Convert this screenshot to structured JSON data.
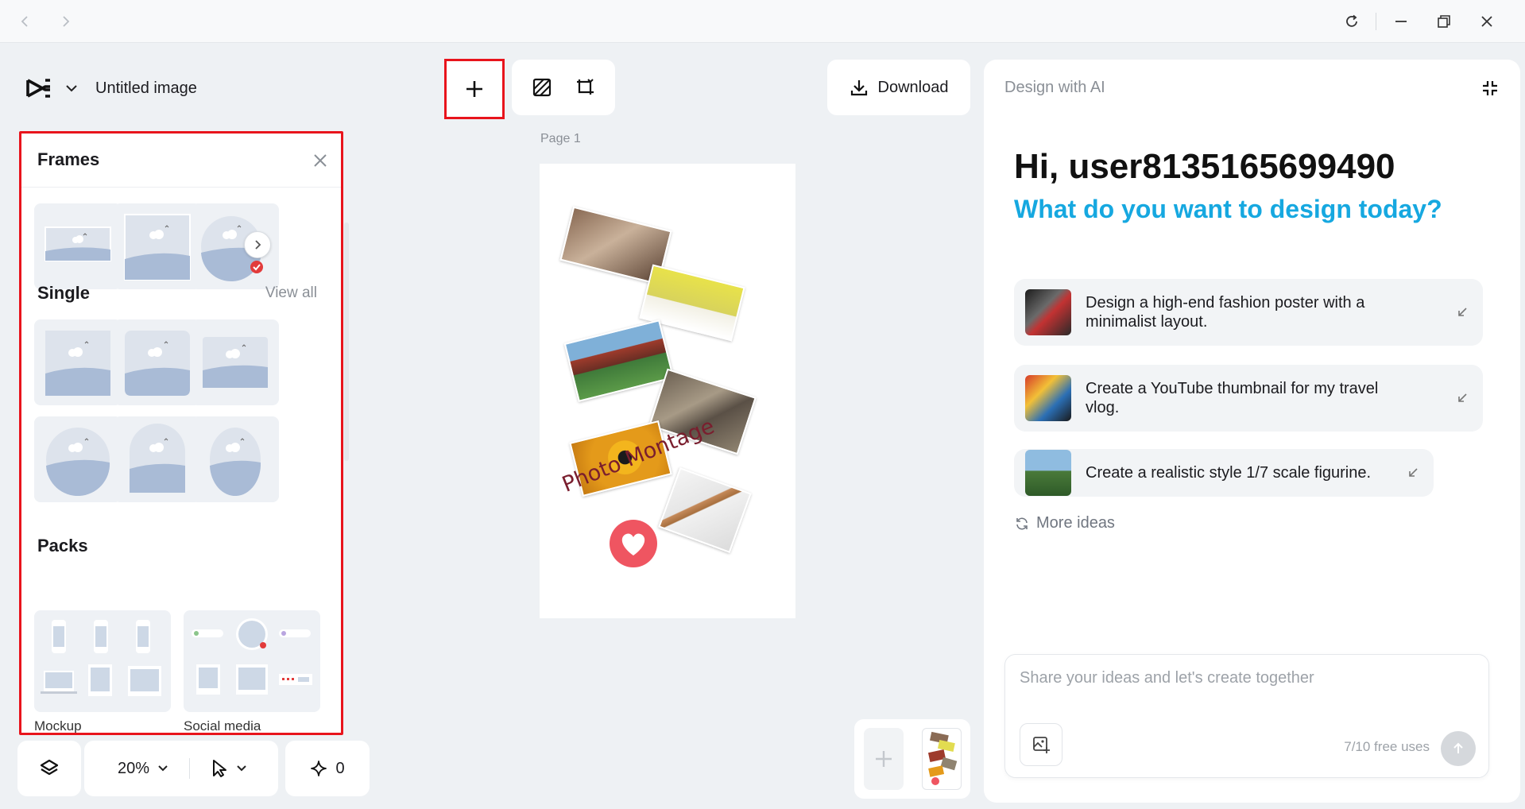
{
  "app": {
    "title": "Untitled image"
  },
  "toolbar": {
    "download_label": "Download"
  },
  "frames_panel": {
    "title": "Frames",
    "single_title": "Single",
    "view_all": "View all",
    "packs_title": "Packs",
    "packs": [
      {
        "label": "Mockup"
      },
      {
        "label": "Social media"
      }
    ]
  },
  "bottom_bar": {
    "zoom": "20%",
    "ai_credits": "0"
  },
  "canvas": {
    "page_label": "Page 1",
    "montage_text": "Photo Montage"
  },
  "ai": {
    "title": "Design with AI",
    "greeting": "Hi, user8135165699490",
    "subtitle": "What do you want to design today?",
    "suggestions": [
      {
        "text_line1": "Design a high-end fashion poster with a",
        "text_line2": "minimalist layout."
      },
      {
        "text_line1": "Create a YouTube thumbnail for my travel",
        "text_line2": "vlog."
      },
      {
        "text_line1": "Create a realistic style 1/7 scale figurine.",
        "text_line2": ""
      }
    ],
    "more_ideas": "More ideas",
    "prompt_placeholder": "Share your ideas and let's create together",
    "free_uses": "7/10 free uses"
  },
  "colors": {
    "accent_blue": "#16a8e0",
    "highlight_red": "#e8141c",
    "heart": "#ef5561"
  }
}
